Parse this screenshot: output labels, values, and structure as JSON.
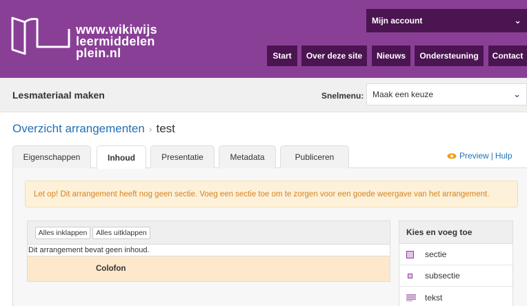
{
  "header": {
    "logo_lines": [
      "www.wikiwijs",
      "leermiddelen",
      "plein.nl"
    ],
    "account_label": "Mijn account",
    "nav": [
      {
        "label": "Start"
      },
      {
        "label": "Over deze site"
      },
      {
        "label": "Nieuws"
      },
      {
        "label": "Ondersteuning"
      },
      {
        "label": "Contact"
      }
    ]
  },
  "toolbar": {
    "title": "Lesmateriaal maken",
    "snelmenu_label": "Snelmenu:",
    "snelmenu_value": "Maak een keuze"
  },
  "breadcrumb": {
    "parent": "Overzicht arrangementen",
    "separator": "›",
    "current": "test"
  },
  "tabs": [
    {
      "label": "Eigenschappen",
      "active": false
    },
    {
      "label": "Inhoud",
      "active": true
    },
    {
      "label": "Presentatie",
      "active": false
    },
    {
      "label": "Metadata",
      "active": false
    },
    {
      "label": "Publiceren",
      "active": false
    }
  ],
  "links": {
    "preview": "Preview",
    "divider": "|",
    "help": "Hulp"
  },
  "warning": "Let op! Dit arrangement heeft nog geen sectie. Voeg een sectie toe om te zorgen voor een goede weergave van het arrangement.",
  "structure": {
    "collapse_all": "Alles inklappen",
    "expand_all": "Alles uitklappen",
    "empty_message": "Dit arrangement bevat geen inhoud.",
    "colofon": "Colofon"
  },
  "add_panel": {
    "title": "Kies en voeg toe",
    "items": [
      {
        "label": "sectie",
        "icon": "section-icon"
      },
      {
        "label": "subsectie",
        "icon": "subsection-icon"
      },
      {
        "label": "tekst",
        "icon": "text-icon"
      }
    ]
  },
  "colors": {
    "header": "#8a3f97",
    "nav": "#4b1551",
    "link": "#1f6fb5",
    "warning_text": "#d6821e"
  }
}
